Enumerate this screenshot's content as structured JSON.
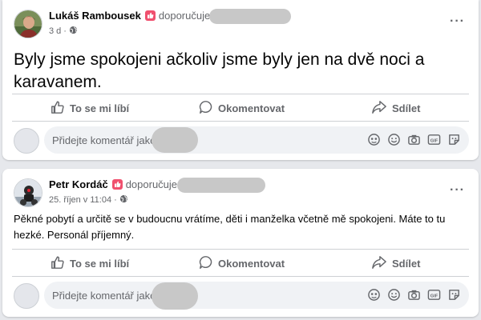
{
  "posts": [
    {
      "author": "Lukáš Rambousek",
      "recommend_text": "doporučuje",
      "time": "3 d",
      "text": "Byly jsme spokojeni ačkoliv jsme byly jen na dvě noci a karavanem.",
      "actions": {
        "like": "To se mi líbí",
        "comment": "Okomentovat",
        "share": "Sdílet"
      },
      "comment_placeholder": "Přidejte komentář jako"
    },
    {
      "author": "Petr Kordáč",
      "recommend_text": "doporučuje",
      "time": "25. říjen v 11:04",
      "text": "Pěkné pobytí a určitě se v budoucnu vrátíme, děti i manželka včetně mě spokojeni. Máte to tu hezké. Personál příjemný.",
      "actions": {
        "like": "To se mi líbí",
        "comment": "Okomentovat",
        "share": "Sdílet"
      },
      "comment_placeholder": "Přidejte komentář jako"
    }
  ],
  "colors": {
    "badge": "#f0506e",
    "secondary_text": "#65676b",
    "divider": "#ced0d4",
    "comment_bg": "#f0f2f5"
  },
  "icons": {
    "privacy": "globe-icon",
    "like": "thumbs-up-icon",
    "comment": "speech-bubble-icon",
    "share": "share-arrow-icon",
    "comment_tools": [
      "avatar-sticker-icon",
      "emoji-icon",
      "camera-icon",
      "gif-icon",
      "sticker-icon"
    ]
  }
}
